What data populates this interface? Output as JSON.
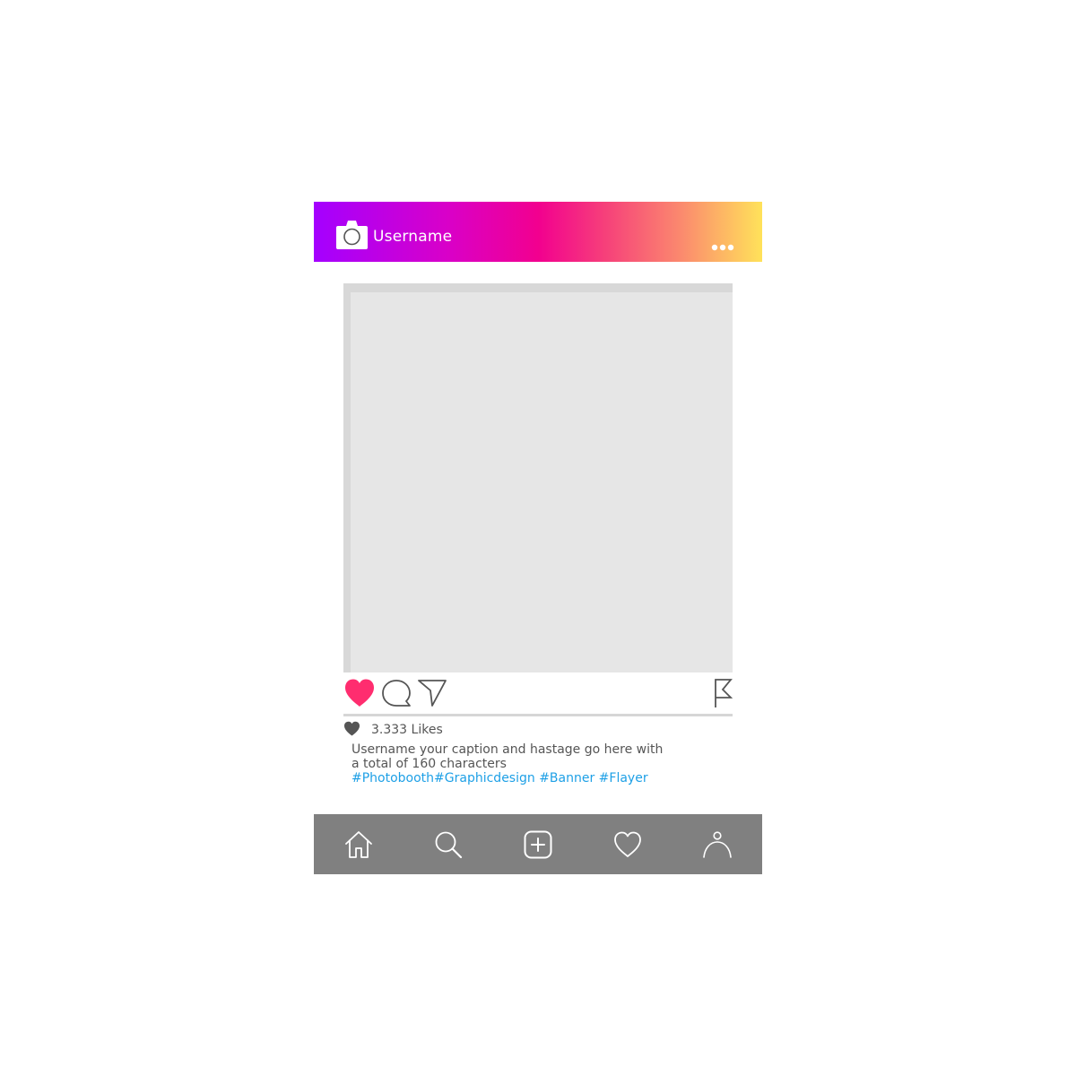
{
  "header": {
    "username": "Username",
    "gradient_colors": [
      "#a400ff",
      "#f2008f",
      "#ffe25a"
    ]
  },
  "post": {
    "placeholder_color": "#e6e6e6"
  },
  "actions": {
    "like_color": "#ff2d6f",
    "icons": [
      "heart-icon",
      "comment-icon",
      "send-icon",
      "flag-icon"
    ]
  },
  "likes": {
    "text": "3.333 Likes"
  },
  "caption": {
    "line1": "Username your caption and hastage go here with",
    "line2": "a total of 160 characters",
    "hashtags": "#Photobooth#Graphicdesign #Banner #Flayer",
    "hashtag_color": "#1ea0e6"
  },
  "bottom_nav": {
    "background": "#808080",
    "items": [
      "home-icon",
      "search-icon",
      "add-post-icon",
      "activity-heart-icon",
      "profile-icon"
    ]
  }
}
